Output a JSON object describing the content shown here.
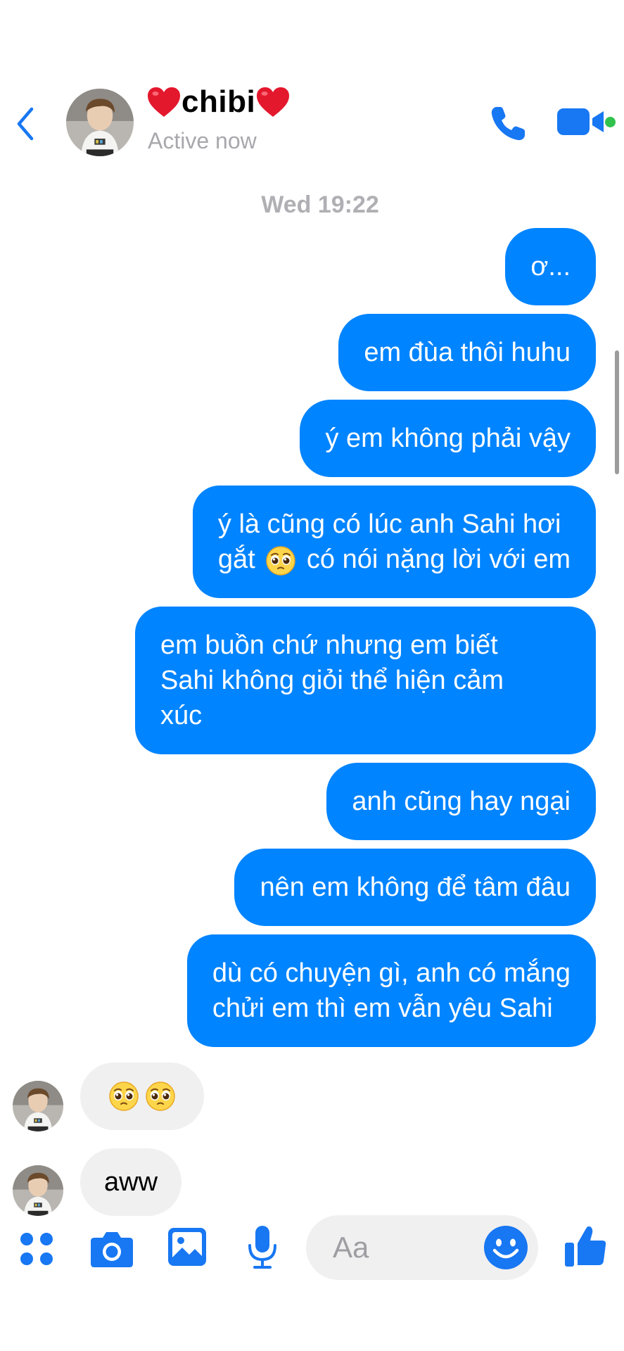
{
  "header": {
    "contact_name": "chibi",
    "status": "Active now",
    "icons": {
      "back": "chevron-left-icon",
      "name_decoration": "red-heart-emoji",
      "call": "phone-icon",
      "video": "video-camera-icon",
      "presence": "active-dot-icon"
    }
  },
  "conversation": {
    "timestamp": "Wed 19:22",
    "outgoing": [
      {
        "text": "ơ..."
      },
      {
        "text": "em đùa thôi huhu"
      },
      {
        "text": "ý em không phải vậy"
      },
      {
        "line1": "ý là cũng có lúc anh Sahi hơi",
        "line2_before": "gắt",
        "line2_emoji": "pleading-face-emoji",
        "line2_after": "có nói nặng lời với em"
      },
      {
        "line1": "em buồn chứ nhưng em biết",
        "line2": "Sahi không giỏi thể hiện cảm",
        "line3": "xúc"
      },
      {
        "text": "anh cũng hay ngại"
      },
      {
        "text": "nên em không để tâm đâu"
      },
      {
        "line1": "dù có chuyện gì, anh có mắng",
        "line2": "chửi em thì em vẫn yêu Sahi"
      }
    ],
    "incoming": [
      {
        "content": "pleading-face-emoji x2",
        "emoji_count": 2
      },
      {
        "text": "aww"
      }
    ]
  },
  "composer": {
    "placeholder": "Aa",
    "icons": {
      "more": "four-dots-menu-icon",
      "camera": "camera-icon",
      "gallery": "image-icon",
      "voice": "microphone-icon",
      "emoji": "smiley-icon",
      "like": "thumbs-up-icon"
    }
  },
  "colors": {
    "accent": "#0084ff",
    "incoming_bubble": "#f0f0f0",
    "secondary_text": "#a8a8ad",
    "heart": "#e3182d",
    "presence": "#31c24d",
    "icon_blue": "#1877f2"
  }
}
